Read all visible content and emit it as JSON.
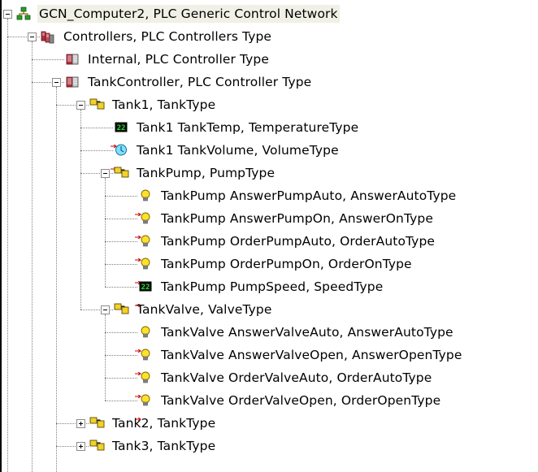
{
  "tree": {
    "nodes": [
      {
        "name": "root-node",
        "label": "GCN_Computer2, PLC Generic Control Network",
        "icon": "network-icon",
        "expander": "minus",
        "level": 0,
        "root": true
      },
      {
        "name": "controllers-node",
        "label": "Controllers, PLC Controllers Type",
        "icon": "controllers-folder-icon",
        "expander": "minus",
        "level": 1
      },
      {
        "name": "internal-node",
        "label": "Internal, PLC Controller Type",
        "icon": "plc-controller-icon",
        "expander": "none",
        "level": 2
      },
      {
        "name": "tankcontroller-node",
        "label": "TankController, PLC Controller Type",
        "icon": "plc-controller-icon",
        "expander": "minus",
        "level": 2
      },
      {
        "name": "tank1-node",
        "label": "Tank1, TankType",
        "icon": "object-folder-icon",
        "expander": "minus",
        "level": 3
      },
      {
        "name": "tank1-temp-node",
        "label": "Tank1 TankTemp, TemperatureType",
        "icon": "numeric-value-icon",
        "expander": "none",
        "level": 4
      },
      {
        "name": "tank1-volume-node",
        "label": "Tank1 TankVolume, VolumeType",
        "icon": "volume-icon",
        "expander": "none",
        "level": 4
      },
      {
        "name": "tankpump-node",
        "label": "TankPump, PumpType",
        "icon": "object-folder-icon",
        "expander": "minus",
        "level": 4
      },
      {
        "name": "pump-answer-auto-node",
        "label": "TankPump AnswerPumpAuto, AnswerAutoType",
        "icon": "lightbulb-icon",
        "expander": "none",
        "level": 5
      },
      {
        "name": "pump-answer-on-node",
        "label": "TankPump AnswerPumpOn, AnswerOnType",
        "icon": "lightbulb-icon",
        "expander": "none",
        "level": 5
      },
      {
        "name": "pump-order-auto-node",
        "label": "TankPump OrderPumpAuto, OrderAutoType",
        "icon": "lightbulb-icon",
        "expander": "none",
        "level": 5
      },
      {
        "name": "pump-order-on-node",
        "label": "TankPump OrderPumpOn, OrderOnType",
        "icon": "lightbulb-icon",
        "expander": "none",
        "level": 5
      },
      {
        "name": "pump-speed-node",
        "label": "TankPump PumpSpeed, SpeedType",
        "icon": "numeric-value-icon",
        "expander": "none",
        "level": 5
      },
      {
        "name": "tankvalve-node",
        "label": "TankValve, ValveType",
        "icon": "object-folder-icon",
        "expander": "minus",
        "level": 4
      },
      {
        "name": "valve-answer-auto-node",
        "label": "TankValve AnswerValveAuto, AnswerAutoType",
        "icon": "lightbulb-icon",
        "expander": "none",
        "level": 5
      },
      {
        "name": "valve-answer-open-node",
        "label": "TankValve AnswerValveOpen, AnswerOpenType",
        "icon": "lightbulb-icon",
        "expander": "none",
        "level": 5
      },
      {
        "name": "valve-order-auto-node",
        "label": "TankValve OrderValveAuto, OrderAutoType",
        "icon": "lightbulb-icon",
        "expander": "none",
        "level": 5
      },
      {
        "name": "valve-order-open-node",
        "label": "TankValve OrderValveOpen, OrderOpenType",
        "icon": "lightbulb-icon",
        "expander": "none",
        "level": 5
      },
      {
        "name": "tank2-node",
        "label": "Tank2, TankType",
        "icon": "object-folder-icon",
        "expander": "plus",
        "level": 3
      },
      {
        "name": "tank3-node",
        "label": "Tank3, TankType",
        "icon": "object-folder-icon",
        "expander": "plus",
        "level": 3
      }
    ]
  },
  "colors": {
    "root_highlight": "#f0f0e6",
    "tree_lines": "#808080",
    "link_arrow": "#cc0000"
  }
}
